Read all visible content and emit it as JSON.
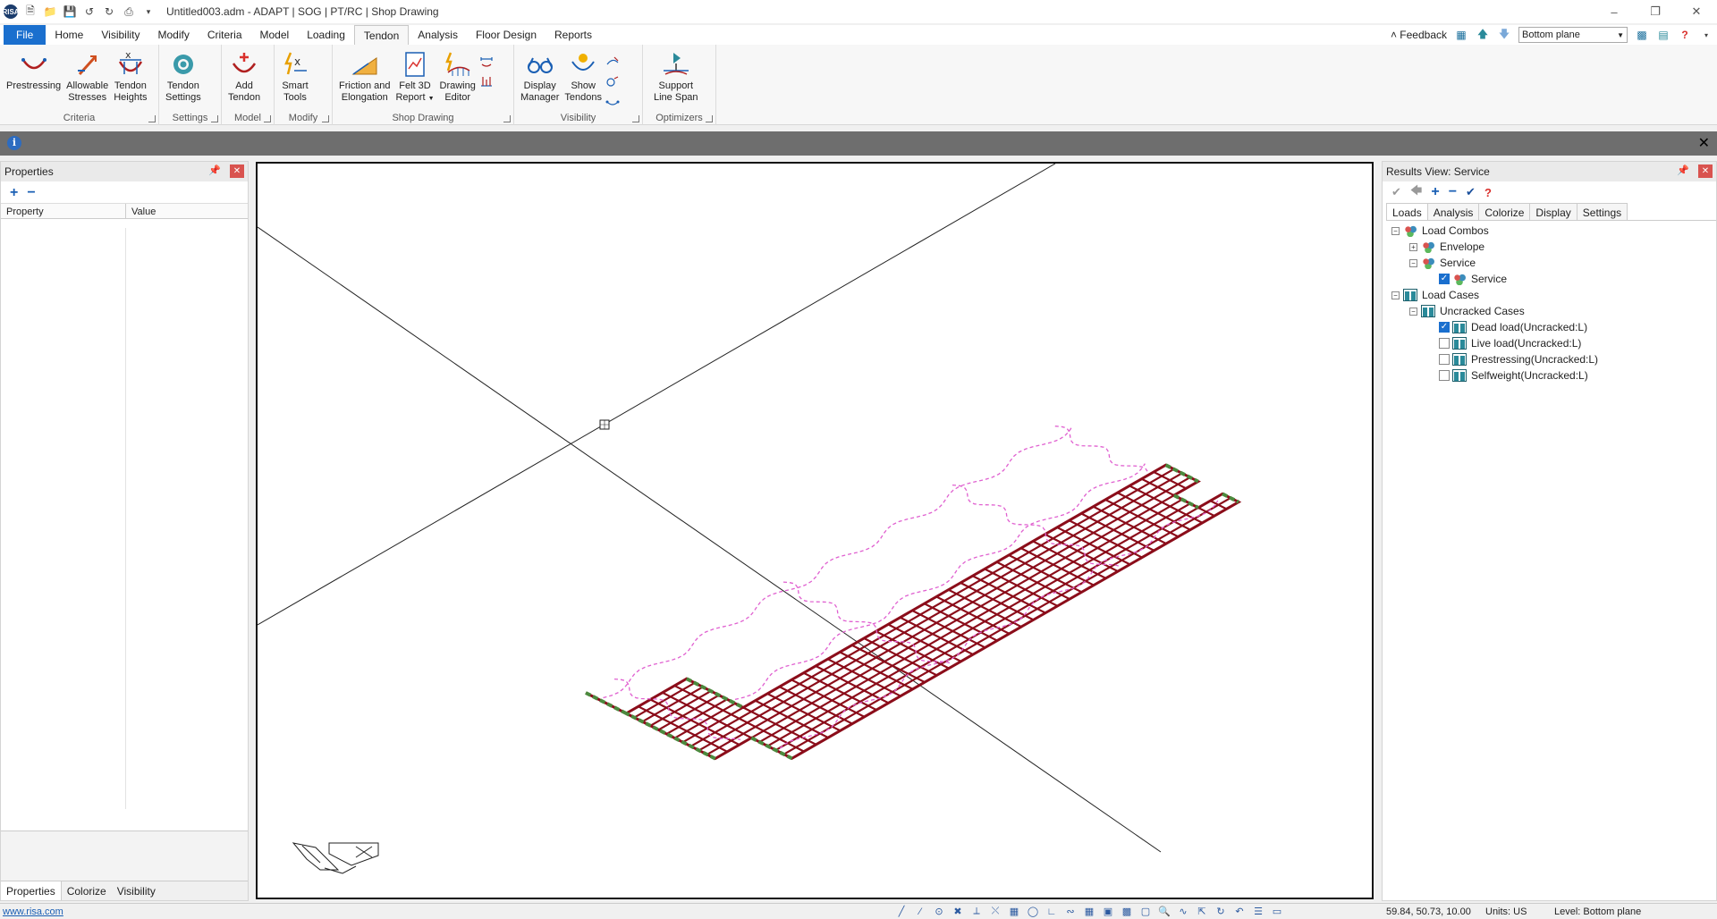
{
  "window": {
    "title": "Untitled003.adm - ADAPT | SOG | PT/RC | Shop Drawing",
    "logo_text": "RISA"
  },
  "tabs": [
    "File",
    "Home",
    "Visibility",
    "Modify",
    "Criteria",
    "Model",
    "Loading",
    "Tendon",
    "Analysis",
    "Floor Design",
    "Reports"
  ],
  "active_tab": "Tendon",
  "toolbar_right": {
    "feedback": "Feedback",
    "plane_select": "Bottom plane"
  },
  "ribbon": {
    "criteria": {
      "label": "Criteria",
      "prestressing": "Prestressing",
      "allowable_1": "Allowable",
      "allowable_2": "Stresses",
      "heights_1": "Tendon",
      "heights_2": "Heights"
    },
    "settings": {
      "label": "Settings",
      "btn_1": "Tendon",
      "btn_2": "Settings"
    },
    "model": {
      "label": "Model",
      "btn_1": "Add",
      "btn_2": "Tendon"
    },
    "modify": {
      "label": "Modify",
      "btn_1": "Smart",
      "btn_2": "Tools"
    },
    "shop": {
      "label": "Shop Drawing",
      "friction_1": "Friction and",
      "friction_2": "Elongation",
      "felt_1": "Felt 3D",
      "felt_2": "Report",
      "editor_1": "Drawing",
      "editor_2": "Editor"
    },
    "visibility": {
      "label": "Visibility",
      "display_1": "Display",
      "display_2": "Manager",
      "show_1": "Show",
      "show_2": "Tendons"
    },
    "optimizers": {
      "label": "Optimizers",
      "btn_1": "Support",
      "btn_2": "Line Span"
    }
  },
  "left_panel": {
    "title": "Properties",
    "col_property": "Property",
    "col_value": "Value",
    "bottom_tabs": [
      "Properties",
      "Colorize",
      "Visibility"
    ]
  },
  "right_panel": {
    "title": "Results View: Service",
    "tabs": [
      "Loads",
      "Analysis",
      "Colorize",
      "Display",
      "Settings"
    ],
    "tree": {
      "load_combos": "Load Combos",
      "envelope": "Envelope",
      "service_group": "Service",
      "service_item": "Service",
      "load_cases": "Load Cases",
      "uncracked": "Uncracked Cases",
      "cases": [
        {
          "label": "Dead load(Uncracked:L)",
          "checked": true
        },
        {
          "label": "Live load(Uncracked:L)",
          "checked": false
        },
        {
          "label": "Prestressing(Uncracked:L)",
          "checked": false
        },
        {
          "label": "Selfweight(Uncracked:L)",
          "checked": false
        }
      ]
    }
  },
  "status": {
    "website": "www.risa.com",
    "coords": "59.84, 50.73, 10.00",
    "units": "Units: US",
    "level": "Level: Bottom plane"
  },
  "colors": {
    "mesh": "#8b0d1a",
    "edge": "#4c8a3e",
    "tendon": "#e060d0",
    "accent": "#1a6fce"
  }
}
